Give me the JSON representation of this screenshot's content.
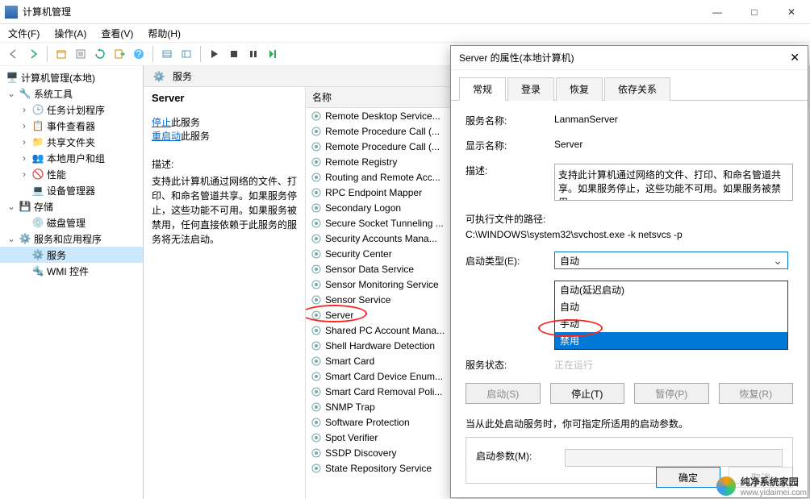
{
  "window": {
    "title": "计算机管理"
  },
  "win_controls": {
    "min": "—",
    "max": "□",
    "close": "✕"
  },
  "menu": {
    "file": "文件(F)",
    "action": "操作(A)",
    "view": "查看(V)",
    "help": "帮助(H)"
  },
  "tree": {
    "root": "计算机管理(本地)",
    "tools": "系统工具",
    "scheduler": "任务计划程序",
    "eventv": "事件查看器",
    "shared": "共享文件夹",
    "users": "本地用户和组",
    "perf": "性能",
    "devmgr": "设备管理器",
    "storage": "存储",
    "diskmgr": "磁盘管理",
    "svcapps": "服务和应用程序",
    "services": "服务",
    "wmi": "WMI 控件"
  },
  "svc_panel": {
    "header": "服务",
    "name_col": "名称",
    "selected": "Server",
    "stop": "停止",
    "stop_suffix": "此服务",
    "restart": "重启动",
    "restart_suffix": "此服务",
    "desc_label": "描述:",
    "desc": "支持此计算机通过网络的文件、打印、和命名管道共享。如果服务停止，这些功能不可用。如果服务被禁用，任何直接依赖于此服务的服务将无法启动。"
  },
  "services": [
    "Remote Desktop Service...",
    "Remote Procedure Call (...",
    "Remote Procedure Call (...",
    "Remote Registry",
    "Routing and Remote Acc...",
    "RPC Endpoint Mapper",
    "Secondary Logon",
    "Secure Socket Tunneling ...",
    "Security Accounts Mana...",
    "Security Center",
    "Sensor Data Service",
    "Sensor Monitoring Service",
    "Sensor Service",
    "Server",
    "Shared PC Account Mana...",
    "Shell Hardware Detection",
    "Smart Card",
    "Smart Card Device Enum...",
    "Smart Card Removal Poli...",
    "SNMP Trap",
    "Software Protection",
    "Spot Verifier",
    "SSDP Discovery",
    "State Repository Service"
  ],
  "dialog": {
    "title": "Server 的属性(本地计算机)",
    "tabs": {
      "general": "常规",
      "logon": "登录",
      "recovery": "恢复",
      "deps": "依存关系"
    },
    "svc_name_lbl": "服务名称:",
    "svc_name": "LanmanServer",
    "disp_name_lbl": "显示名称:",
    "disp_name": "Server",
    "desc_lbl": "描述:",
    "desc": "支持此计算机通过网络的文件、打印、和命名管道共享。如果服务停止，这些功能不可用。如果服务被禁用，",
    "path_lbl": "可执行文件的路径:",
    "path": "C:\\WINDOWS\\system32\\svchost.exe -k netsvcs -p",
    "start_type_lbl": "启动类型(E):",
    "start_type_val": "自动",
    "options": {
      "auto_delayed": "自动(延迟启动)",
      "auto": "自动",
      "manual": "手动",
      "disabled": "禁用"
    },
    "status_lbl": "服务状态:",
    "status_val": "正在运行",
    "btns": {
      "start": "启动(S)",
      "stop": "停止(T)",
      "pause": "暂停(P)",
      "resume": "恢复(R)"
    },
    "hint": "当从此处启动服务时，你可指定所适用的启动参数。",
    "param_lbl": "启动参数(M):",
    "ok": "确定",
    "cancel": "取消"
  },
  "watermark": {
    "site": "纯净系统家园",
    "url": "www.yidaimei.com"
  }
}
